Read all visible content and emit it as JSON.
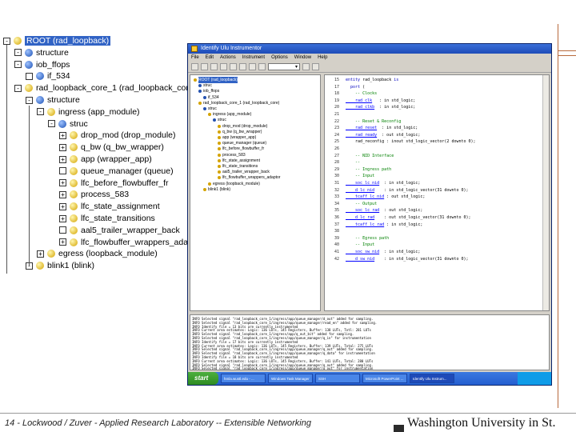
{
  "tree": {
    "items": [
      {
        "label": "ROOT (rad_loopback)",
        "box": "-",
        "ball": "yellow",
        "selected": true
      },
      {
        "label": "structure",
        "box": "-",
        "ball": "blue"
      },
      {
        "label": "iob_ffops",
        "box": "-",
        "ball": "blue"
      },
      {
        "label": "if_534",
        "box": "",
        "ball": "blue"
      },
      {
        "label": "rad_loopback_core_1 (rad_loopback_core)",
        "box": "-",
        "ball": "yellow"
      },
      {
        "label": "structure",
        "box": "-",
        "ball": "blue"
      },
      {
        "label": "ingress (app_module)",
        "box": "-",
        "ball": "yellow"
      },
      {
        "label": "struc",
        "box": "-",
        "ball": "blue"
      },
      {
        "label": "drop_mod (drop_module)",
        "box": "+",
        "ball": "yellow"
      },
      {
        "label": "q_bw (q_bw_wrapper)",
        "box": "+",
        "ball": "yellow"
      },
      {
        "label": "app (wrapper_app)",
        "box": "+",
        "ball": "yellow"
      },
      {
        "label": "queue_manager (queue)",
        "box": "",
        "ball": "yellow"
      },
      {
        "label": "lfc_before_flowbuffer_fr",
        "box": "+",
        "ball": "yellow"
      },
      {
        "label": "process_583",
        "box": "+",
        "ball": "yellow"
      },
      {
        "label": "lfc_state_assignment",
        "box": "+",
        "ball": "yellow"
      },
      {
        "label": "lfc_state_transitions",
        "box": "+",
        "ball": "yellow"
      },
      {
        "label": "aal5_trailer_wrapper_back",
        "box": "",
        "ball": "yellow"
      },
      {
        "label": "lfc_flowbuffer_wrappers_adaptor",
        "box": "+",
        "ball": "yellow"
      },
      {
        "label": "egress (loopback_module)",
        "box": "+",
        "ball": "yellow"
      },
      {
        "label": "blink1 (blink)",
        "box": "-",
        "ball": "yellow"
      }
    ]
  },
  "window": {
    "title": "Identify Ulu Instrumentor",
    "menu": [
      "File",
      "Edit",
      "Actions",
      "Instrument",
      "Options",
      "Window",
      "Help"
    ],
    "toolbar_select": "▾"
  },
  "mini_tree": [
    {
      "label": "ROOT (rad_loopback)",
      "ball": "y",
      "selected": true
    },
    {
      "label": "struc",
      "ball": "b"
    },
    {
      "label": "iob_ffops",
      "ball": "b"
    },
    {
      "label": "if_534",
      "ball": "b"
    },
    {
      "label": "rad_loopback_core_1 (rad_loopback_core)",
      "ball": "y"
    },
    {
      "label": "struc",
      "ball": "b"
    },
    {
      "label": "ingress (app_module)",
      "ball": "y"
    },
    {
      "label": "struc",
      "ball": "b"
    },
    {
      "label": "drop_mod (drop_module)",
      "ball": "y"
    },
    {
      "label": "q_bw (q_bw_wrapper)",
      "ball": "y"
    },
    {
      "label": "app (wrapper_app)",
      "ball": "y"
    },
    {
      "label": "queue_manager (queue)",
      "ball": "y"
    },
    {
      "label": "lfc_before_flowbuffer_fr",
      "ball": "y"
    },
    {
      "label": "process_583",
      "ball": "y"
    },
    {
      "label": "lfc_state_assignment",
      "ball": "y"
    },
    {
      "label": "lfc_state_transitions",
      "ball": "y"
    },
    {
      "label": "aal5_trailer_wrapper_back",
      "ball": "y"
    },
    {
      "label": "lfc_flowbuffer_wrappers_adaptor",
      "ball": "y"
    },
    {
      "label": "egress (loopback_module)",
      "ball": "y"
    },
    {
      "label": "blink1 (blink)",
      "ball": "y"
    }
  ],
  "code": [
    {
      "ln": "15",
      "parts": [
        {
          "c": "kw",
          "t": "entity "
        },
        {
          "c": "tx",
          "t": "rad_loopback "
        },
        {
          "c": "kw",
          "t": "is"
        }
      ]
    },
    {
      "ln": "17",
      "parts": [
        {
          "c": "kw",
          "t": "  port "
        },
        {
          "c": "tx",
          "t": "("
        }
      ]
    },
    {
      "ln": "18",
      "parts": [
        {
          "c": "cm",
          "t": "    -- Clocks"
        }
      ]
    },
    {
      "ln": "19",
      "parts": [
        {
          "c": "ic",
          "t": "    rad_clk"
        },
        {
          "c": "tx",
          "t": "   : in std_logic;"
        }
      ]
    },
    {
      "ln": "20",
      "parts": [
        {
          "c": "ic",
          "t": "    rad_clkb"
        },
        {
          "c": "tx",
          "t": "  : in std_logic;"
        }
      ]
    },
    {
      "ln": "21",
      "parts": [
        {
          "c": "tx",
          "t": ""
        }
      ]
    },
    {
      "ln": "22",
      "parts": [
        {
          "c": "cm",
          "t": "    -- Reset & Reconfig"
        }
      ]
    },
    {
      "ln": "23",
      "parts": [
        {
          "c": "ic",
          "t": "    rad_reset"
        },
        {
          "c": "tx",
          "t": "  : in std_logic;"
        }
      ]
    },
    {
      "ln": "24",
      "parts": [
        {
          "c": "ic",
          "t": "    rad_ready"
        },
        {
          "c": "tx",
          "t": "  : out std_logic;"
        }
      ]
    },
    {
      "ln": "25",
      "parts": [
        {
          "c": "tx",
          "t": "    rad_reconfig : inout std_logic_vector(2 downto 0);"
        }
      ]
    },
    {
      "ln": "26",
      "parts": [
        {
          "c": "tx",
          "t": ""
        }
      ]
    },
    {
      "ln": "27",
      "parts": [
        {
          "c": "cm",
          "t": "    -- NID Interface"
        }
      ]
    },
    {
      "ln": "28",
      "parts": [
        {
          "c": "cm",
          "t": "    --"
        }
      ]
    },
    {
      "ln": "29",
      "parts": [
        {
          "c": "cm",
          "t": "    -- Ingress path"
        }
      ]
    },
    {
      "ln": "30",
      "parts": [
        {
          "c": "cm",
          "t": "    -- Input"
        }
      ]
    },
    {
      "ln": "31",
      "parts": [
        {
          "c": "ic",
          "t": "    soc_lc_nid"
        },
        {
          "c": "tx",
          "t": "  : in std_logic;"
        }
      ]
    },
    {
      "ln": "32",
      "parts": [
        {
          "c": "ic",
          "t": "    d_lc_nid"
        },
        {
          "c": "tx",
          "t": "    : in std_logic_vector(31 downto 0);"
        }
      ]
    },
    {
      "ln": "33",
      "parts": [
        {
          "c": "ic",
          "t": "    tcaff_lc_nid"
        },
        {
          "c": "tx",
          "t": " : out std_logic;"
        }
      ]
    },
    {
      "ln": "34",
      "parts": [
        {
          "c": "cm",
          "t": "    -- Output"
        }
      ]
    },
    {
      "ln": "35",
      "parts": [
        {
          "c": "ic",
          "t": "    soc_lc_rad"
        },
        {
          "c": "tx",
          "t": "  : out std_logic;"
        }
      ]
    },
    {
      "ln": "36",
      "parts": [
        {
          "c": "ic",
          "t": "    d_lc_rad"
        },
        {
          "c": "tx",
          "t": "    : out std_logic_vector(31 downto 0);"
        }
      ]
    },
    {
      "ln": "37",
      "parts": [
        {
          "c": "ic",
          "t": "    tcaff_lc_rad"
        },
        {
          "c": "tx",
          "t": " : in std_logic;"
        }
      ]
    },
    {
      "ln": "38",
      "parts": [
        {
          "c": "tx",
          "t": ""
        }
      ]
    },
    {
      "ln": "39",
      "parts": [
        {
          "c": "cm",
          "t": "    -- Egress path"
        }
      ]
    },
    {
      "ln": "40",
      "parts": [
        {
          "c": "cm",
          "t": "    -- Input"
        }
      ]
    },
    {
      "ln": "41",
      "parts": [
        {
          "c": "ic",
          "t": "    soc_sw_nid"
        },
        {
          "c": "tx",
          "t": "  : in std_logic;"
        }
      ]
    },
    {
      "ln": "42",
      "parts": [
        {
          "c": "ic",
          "t": "    d_sw_nid"
        },
        {
          "c": "tx",
          "t": "    : in std_logic_vector(31 downto 0);"
        }
      ]
    }
  ],
  "log": [
    "INFO Selected signal \"rad_loopback_core_1/ingress/app/queue_manager/d_out\" added for sampling.",
    "INFO Selected signal \"rad_loopback_core_1/ingress/app/queue_manager/read_en\" added for sampling.",
    "INFO Identify file = 13 bits are currently instrumented",
    "INFO Current area estimates: Logic: 136 LUTs, 145 Registers, Buffer: 138 LUTs, Totl: 281 LUTs",
    "INFO Selected signal \"rad_loopback_core_1/ingress/app/q_out_bit\" added for sampling.",
    "INFO Selected signal \"rad_loopback_core_1/ingress/app/queue_manager/q_in\" for instrumentation",
    "INFO Identify file = 17 bits are currently instrumented",
    "INFO Current area estimates: Logic: 136 LUTs, 145 Registers, Buffer: 139 LUTs, Total: 275 LUTs",
    "INFO Selected signal \"rad_loopback_core_1/ingress/app/queue_manager/q_out\" added for sampling.",
    "INFO Selected signal \"rad_loopback_core_1/ingress/app/queue_manager/q_data\" for instrumentation",
    "INFO Identify file = 18 bits are currently instrumented",
    "INFO Current area estimates: Logic: 136 LUTs, 145 Registers, Buffer: 141 LUTs, Total: 280 LUTs",
    "INFO Selected signal \"rad_loopback_core_1/ingress/app/queue_manager/q_out\" added for sampling.",
    "INFO Selected signal \"rad_loopback_core_1/ingress/app/queue_manager/q_out\" for instrumentation"
  ],
  "taskbar": {
    "start": "start",
    "items": [
      "hmla.wustl.edu - ...",
      "Windows Task Manager",
      "SSH",
      "Microsoft PowerPoint ...",
      "Identify Ulu Instrum..."
    ]
  },
  "footer": {
    "text": "14 - Lockwood / Zuver - Applied Research Laboratory -- Extensible Networking",
    "logo": "Washington University in St. Louis"
  }
}
